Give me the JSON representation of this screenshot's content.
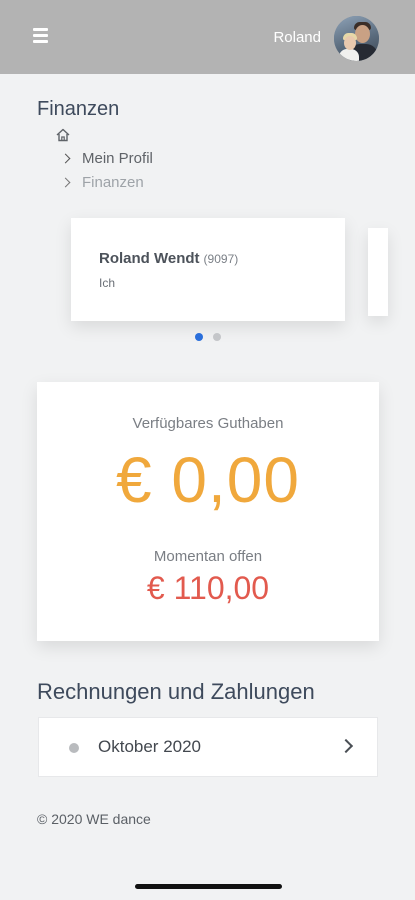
{
  "header": {
    "user_name": "Roland",
    "menu_icon": "hamburger-menu-icon",
    "avatar_icon": "user-avatar"
  },
  "page": {
    "title": "Finanzen"
  },
  "breadcrumb": {
    "home_icon": "home-icon",
    "items": [
      {
        "label": "Mein Profil"
      },
      {
        "label": "Finanzen"
      }
    ]
  },
  "profile_carousel": {
    "cards": [
      {
        "name": "Roland Wendt",
        "id": "(9097)",
        "role": "Ich"
      }
    ],
    "active_index": 0,
    "page_count": 2,
    "active_dot_color": "#2a6fdb"
  },
  "balance": {
    "available_label": "Verfügbares Guthaben",
    "available_value": "€ 0,00",
    "available_color": "#f0a83c",
    "open_label": "Momentan offen",
    "open_value": "€ 110,00",
    "open_color": "#e25a4e"
  },
  "invoices": {
    "title": "Rechnungen und Zahlungen",
    "items": [
      {
        "label": "Oktober 2020"
      }
    ]
  },
  "footer": {
    "text": "© 2020 WE dance"
  }
}
